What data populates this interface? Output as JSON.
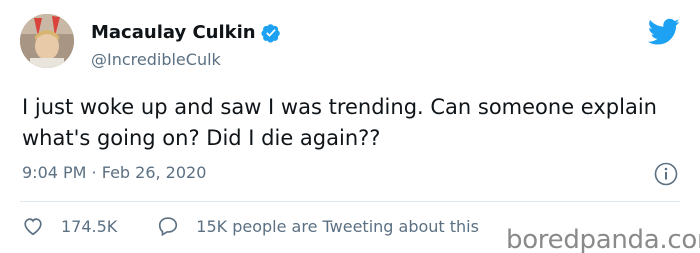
{
  "user": {
    "display_name": "Macaulay Culkin",
    "handle": "@IncredibleCulk"
  },
  "tweet": {
    "text": "I just woke up and saw I was trending. Can someone explain what's going on? Did I die again??",
    "time": "9:04 PM",
    "separator": " · ",
    "date": "Feb 26, 2020"
  },
  "actions": {
    "likes": "174.5K",
    "replies_text": "15K people are Tweeting about this"
  },
  "watermark": "boredpanda.com",
  "icons": {
    "verified": "verified-badge-icon",
    "logo": "twitter-bird-icon",
    "info": "info-icon",
    "like": "heart-icon",
    "reply": "speech-bubble-icon"
  },
  "colors": {
    "twitter_blue": "#1da1f2",
    "text_primary": "#0f1419",
    "text_secondary": "#5b7083",
    "divider": "#e1e8ed"
  }
}
